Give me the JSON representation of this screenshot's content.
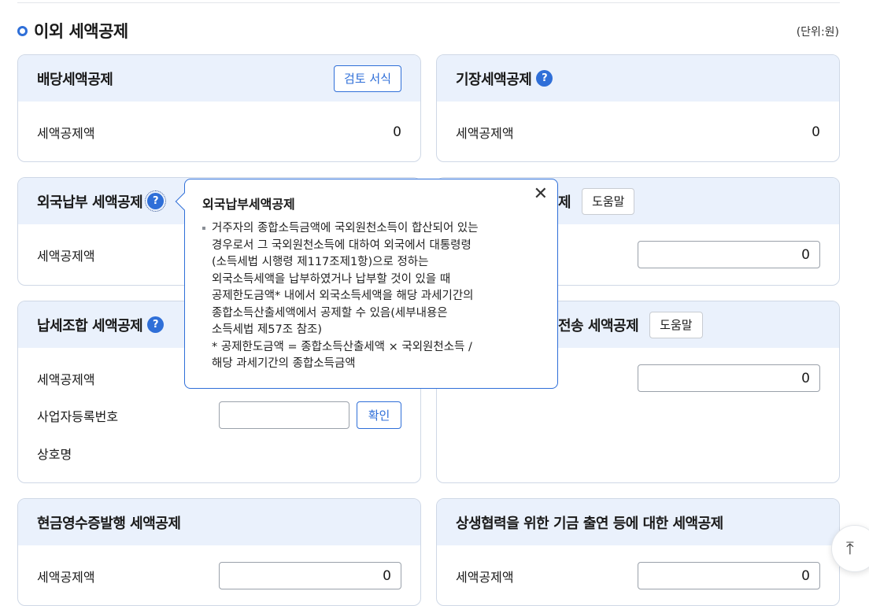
{
  "section": {
    "title": "이외 세액공제",
    "unit": "(단위:원)"
  },
  "cards": {
    "dividend": {
      "title": "배당세액공제",
      "review_button": "검토 서식",
      "row_label": "세액공제액",
      "value": "0"
    },
    "bookkeeping": {
      "title": "기장세액공제",
      "row_label": "세액공제액",
      "value": "0"
    },
    "foreign_tax": {
      "title": "외국납부 세액공제",
      "row_label": "세액공제액"
    },
    "right_mid": {
      "title_fragment": "제",
      "help_button": "도움말",
      "value": "0"
    },
    "tax_union": {
      "title": "납세조합 세액공제",
      "row_label": "세액공제액",
      "bizno_label": "사업자등록번호",
      "confirm_button": "확인",
      "trade_name_label": "상호명"
    },
    "e_transmission": {
      "title_fragment": "전송 세액공제",
      "help_button": "도움말",
      "value": "0"
    },
    "cash_receipt": {
      "title": "현금영수증발행 세액공제",
      "row_label": "세액공제액",
      "value": "0"
    },
    "win_win": {
      "title": "상생협력을 위한 기금 출연 등에 대한 세액공제",
      "row_label": "세액공제액",
      "value": "0"
    }
  },
  "tooltip": {
    "title": "외국납부세액공제",
    "body_lines": [
      "거주자의 종합소득금액에 국외원천소득이 합산되어 있는",
      "경우로서 그 국외원천소득에 대하여 외국에서 대통령령",
      "(소득세법 시행령 제117조제1항)으로 정하는",
      "외국소득세액을 납부하였거나 납부할 것이 있을 때",
      "공제한도금액* 내에서 외국소득세액을 해당 과세기간의",
      "종합소득산출세액에서 공제할 수 있음(세부내용은",
      "소득세법 제57조 참조)"
    ],
    "note_lines": [
      "* 공제한도금액 = 종합소득산출세액 × 국외원천소득 /",
      "해당 과세기간의 종합소득금액"
    ],
    "close_symbol": "✕"
  },
  "icons": {
    "help": "?",
    "scroll_top": "⤒"
  },
  "colors": {
    "accent": "#2f6fd8",
    "card_header": "#eaf1fc",
    "card_border": "#cfd8e6"
  }
}
